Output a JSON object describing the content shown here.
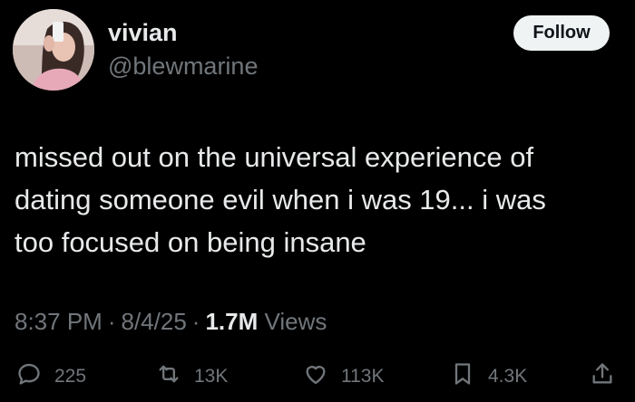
{
  "author": {
    "display_name": "vivian",
    "handle": "@blewmarine"
  },
  "follow_label": "Follow",
  "tweet": {
    "lines": [
      "missed out on the universal experience of",
      "dating someone evil when i was 19... i was",
      "too focused on being insane"
    ]
  },
  "meta": {
    "time": "8:37 PM",
    "date": "8/4/25",
    "views_count": "1.7M",
    "views_label": "Views",
    "separator": "·"
  },
  "actions": {
    "replies": "225",
    "reposts": "13K",
    "likes": "113K",
    "bookmarks": "4.3K"
  },
  "icons": {
    "reply": "reply-icon",
    "repost": "repost-icon",
    "like": "heart-icon",
    "bookmark": "bookmark-icon",
    "share": "share-icon"
  },
  "colors": {
    "background": "#000000",
    "text_primary": "#e7e9ea",
    "text_secondary": "#71767b",
    "follow_bg": "#eff3f4"
  }
}
